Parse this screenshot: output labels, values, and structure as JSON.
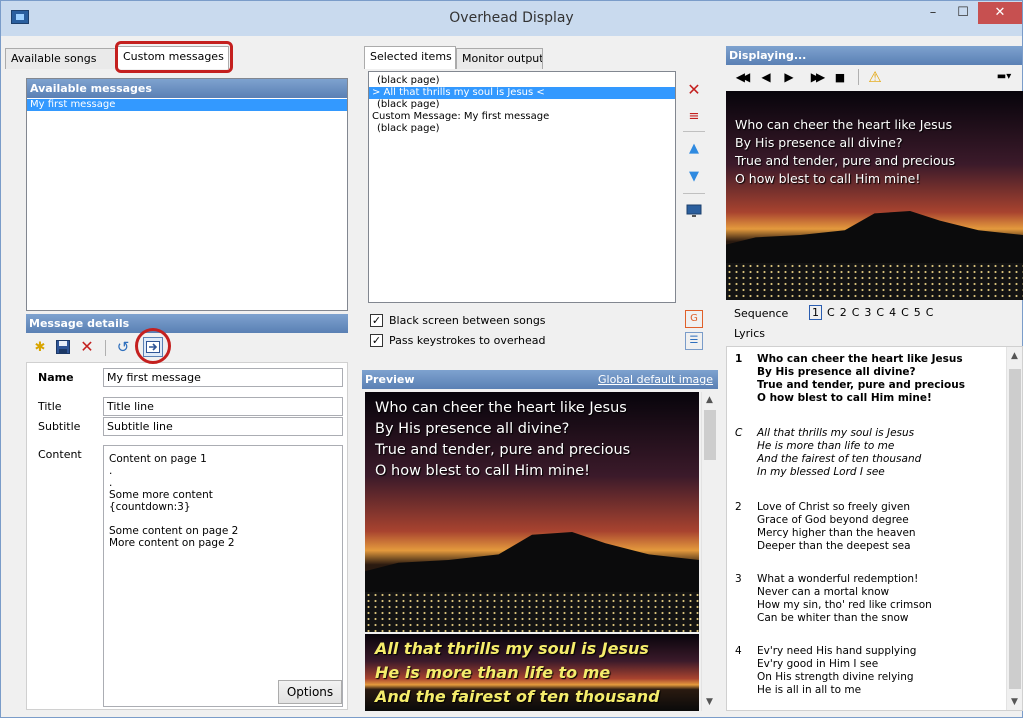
{
  "window": {
    "title": "Overhead Display",
    "min": "–",
    "max": "☐",
    "close": "✕"
  },
  "left": {
    "tabs": [
      "Available songs",
      "Custom messages"
    ],
    "messages_header": "Available messages",
    "messages": [
      "My first message"
    ],
    "details_header": "Message details",
    "labels": {
      "name": "Name",
      "title": "Title",
      "subtitle": "Subtitle",
      "content": "Content"
    },
    "fields": {
      "name": "My first message",
      "title": "Title line",
      "subtitle": "Subtitle line"
    },
    "content_lines": [
      "Content on page 1",
      ".",
      ".",
      "Some more content",
      "{countdown:3}",
      "",
      "Some content on page 2",
      "More content on page 2"
    ],
    "options_button": "Options"
  },
  "middle": {
    "tabs": [
      "Selected items",
      "Monitor output"
    ],
    "items": [
      "(black page)",
      "> All that thrills my soul is Jesus <",
      "(black page)",
      "Custom Message: My first message",
      "(black page)"
    ],
    "checkbox1": {
      "label": "Black screen between songs",
      "checked": true
    },
    "checkbox2": {
      "label": "Pass keystrokes to overhead",
      "checked": true
    },
    "preview_header": "Preview",
    "global_image_link": "Global default image",
    "preview_top_lines": [
      "Who can cheer the heart like Jesus",
      "By His presence all divine?",
      "True and tender, pure and precious",
      "O how blest to call Him mine!"
    ],
    "preview_bottom_lines": [
      "All that thrills my soul is Jesus",
      "He is more than life to me",
      "And the fairest of ten thousand"
    ]
  },
  "right": {
    "displaying_header": "Displaying...",
    "display_lines": [
      "Who can cheer the heart like Jesus",
      "By His presence all divine?",
      "True and tender, pure and precious",
      "O how blest to call Him mine!"
    ],
    "sequence_label": "Sequence",
    "sequence": [
      "1",
      "C",
      "2",
      "C",
      "3",
      "C",
      "4",
      "C",
      "5",
      "C"
    ],
    "lyrics_label": "Lyrics",
    "stanzas": [
      {
        "num": "1",
        "lines": [
          "Who can cheer the heart like Jesus",
          "By His presence all divine?",
          "True and tender, pure and precious",
          "O how blest to call Him mine!"
        ]
      },
      {
        "num": "C",
        "lines": [
          "All that thrills my soul is Jesus",
          "He is more than life to me",
          "And the fairest of ten thousand",
          "In my blessed Lord I see"
        ]
      },
      {
        "num": "2",
        "lines": [
          "Love of Christ so freely given",
          "Grace of God beyond degree",
          "Mercy higher than the heaven",
          "Deeper than the deepest sea"
        ]
      },
      {
        "num": "3",
        "lines": [
          "What a wonderful redemption!",
          "Never can a mortal know",
          "How my sin, tho' red like crimson",
          "Can be whiter than the snow"
        ]
      },
      {
        "num": "4",
        "lines": [
          "Ev'ry need His hand supplying",
          "Ev'ry good in Him I see",
          "On His strength divine relying",
          "He is all in all to me"
        ]
      }
    ]
  }
}
